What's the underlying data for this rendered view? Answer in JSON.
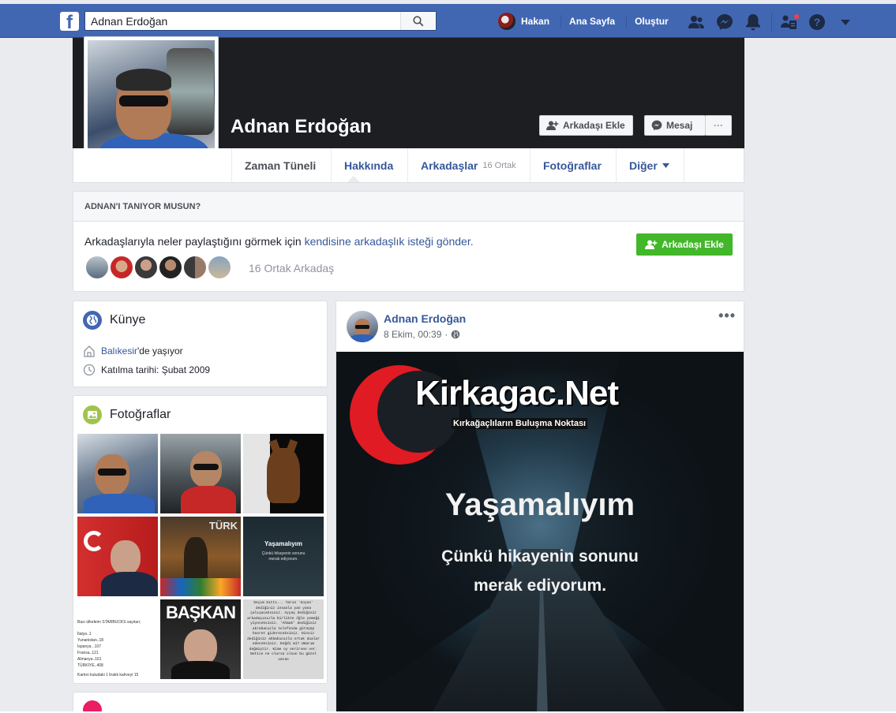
{
  "topbar": {
    "search_value": "Adnan Erdoğan",
    "user_name": "Hakan",
    "home_label": "Ana Sayfa",
    "create_label": "Oluştur",
    "icons": [
      "friend-requests-icon",
      "messenger-icon",
      "notifications-icon",
      "quick-help-icon",
      "help-icon",
      "account-menu-icon"
    ],
    "notification_dot_color": "#fa3e3e"
  },
  "profile": {
    "name": "Adnan Erdoğan",
    "add_friend_label": "Arkadaşı Ekle",
    "message_label": "Mesaj",
    "more_label": "···"
  },
  "tabs": [
    {
      "label": "Zaman Tüneli"
    },
    {
      "label": "Hakkında"
    },
    {
      "label": "Arkadaşlar",
      "count": "16 Ortak"
    },
    {
      "label": "Fotoğraflar"
    },
    {
      "label": "Diğer"
    }
  ],
  "know_card": {
    "header": "ADNAN'I TANIYOR MUSUN?",
    "text_before": "Arkadaşlarıyla neler paylaştığını görmek için ",
    "text_link": "kendisine arkadaşlık isteği gönder.",
    "add_button": "Arkadaşı Ekle",
    "mutual_count": "16 Ortak Arkadaş"
  },
  "intro": {
    "title": "Künye",
    "lives_city": "Balıkesir",
    "lives_suffix": "'de yaşıyor",
    "joined": "Katılma tarihi: Şubat 2009"
  },
  "photos": {
    "title": "Fotoğraflar",
    "thumb_texts": {
      "turk": "TÜRK",
      "yasamaliyim": "Yaşamalıyım",
      "yasamaliyim_sub": "Çünkü hikayenin sonunu merak ediyorum.",
      "starbucks": "Bazı ülkelerin STARBUCKS sayıları;",
      "starbucks_list": "İtalya..1 Yunanistan..18 İspanya ..107 Fransa..121 Almanya..161 TÜRKİYE..408",
      "starbucks_foot": "Karton kutudaki 1 liralık kahveyi 15",
      "baskan": "BAŞKAN",
      "secim": "Seçim bitti... Yarın 'koyun' dediğiniz insanla yan yana çalışacaksınız. Ayyaş dediğiniz arkadaşınızla birlikte öğle yemeği yiyeceksiniz. 'Ahmak' dediğiniz akrabanızla telefonda görüşüp hasret gidereceksiniz. Dinsiz dediğiniz ahbabınızla ortak dualar edeceksiniz. Değdi mi? Umarım değmiştir. Kime oy verirsen ver. Netice ne olursa olsun bu güzel vatan"
    }
  },
  "post": {
    "author": "Adnan Erdoğan",
    "time": "8 Ekim, 00:39",
    "separator": "·",
    "more": "•••",
    "image_brand": "Kirkagac.Net",
    "image_brand_sub": "Kırkağaçlıların Buluşma Noktası",
    "image_title": "Yaşamalıyım",
    "image_line1": "Çünkü hikayenin sonunu",
    "image_line2": "merak ediyorum."
  },
  "colors": {
    "topbar": "#4267b2",
    "link": "#365899",
    "green_button": "#42b72a",
    "cover": "#1c1e21"
  }
}
